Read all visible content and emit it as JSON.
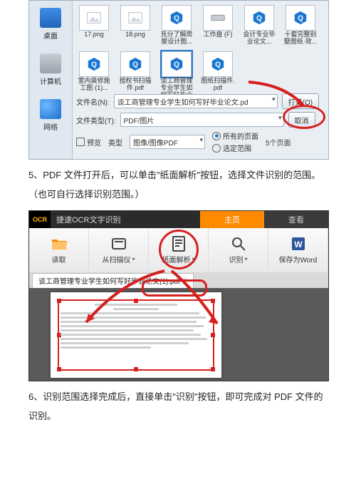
{
  "dialog": {
    "nav": {
      "desktop": "桌面",
      "computer": "计算机",
      "network": "网络"
    },
    "thumbs": [
      {
        "label": "17.png",
        "kind": "img"
      },
      {
        "label": "18.png",
        "kind": "img"
      },
      {
        "label": "充分了解房屋设计图...",
        "kind": "q"
      },
      {
        "label": "工作盘 (F)",
        "kind": "drive"
      },
      {
        "label": "会计专业毕业论文...",
        "kind": "q"
      },
      {
        "label": "十套完整别墅图纸·效...",
        "kind": "q"
      },
      {
        "label": "室内装修施工图·(1)...",
        "kind": "q"
      },
      {
        "label": "授权书扫描件.pdf",
        "kind": "q"
      },
      {
        "label": "谈工商管理专业学生如何写好毕业论文...",
        "kind": "q",
        "selected": true
      },
      {
        "label": "图纸扫描件.pdf",
        "kind": "q"
      }
    ],
    "filename_label": "文件名(N):",
    "filename_value": "谈工商管理专业学生如何写好毕业论文.pd",
    "filetype_label": "文件类型(T):",
    "filetype_value": "PDF/图片",
    "open_btn": "打开(O)",
    "cancel_btn": "取消",
    "preview": "预览",
    "type_label": "类型",
    "type_value": "图像/图像PDF",
    "opt_all": "所有的页面",
    "opt_range": "选定范围",
    "pages_hint": "5个页面"
  },
  "para1": "5、PDF 文件打开后，可以单击\"纸面解析\"按钮，选择文件识别的范围。（也可自行选择识别范围。）",
  "para2": "6、识别范围选择完成后，直接单击\"识别\"按钮，即可完成对 PDF 文件的识别。",
  "ocr": {
    "brand": "OCR",
    "title": "捷速OCR文字识别",
    "tab_active": "主页",
    "tab_inactive": "查看",
    "tool_read": "读取",
    "tool_scan": "从扫描仪",
    "tool_parse": "纸面解析",
    "tool_recognize": "识别",
    "tool_save": "保存为Word",
    "doc_tab": "谈工商管理专业学生如何写好毕业论文(1).pdf"
  }
}
